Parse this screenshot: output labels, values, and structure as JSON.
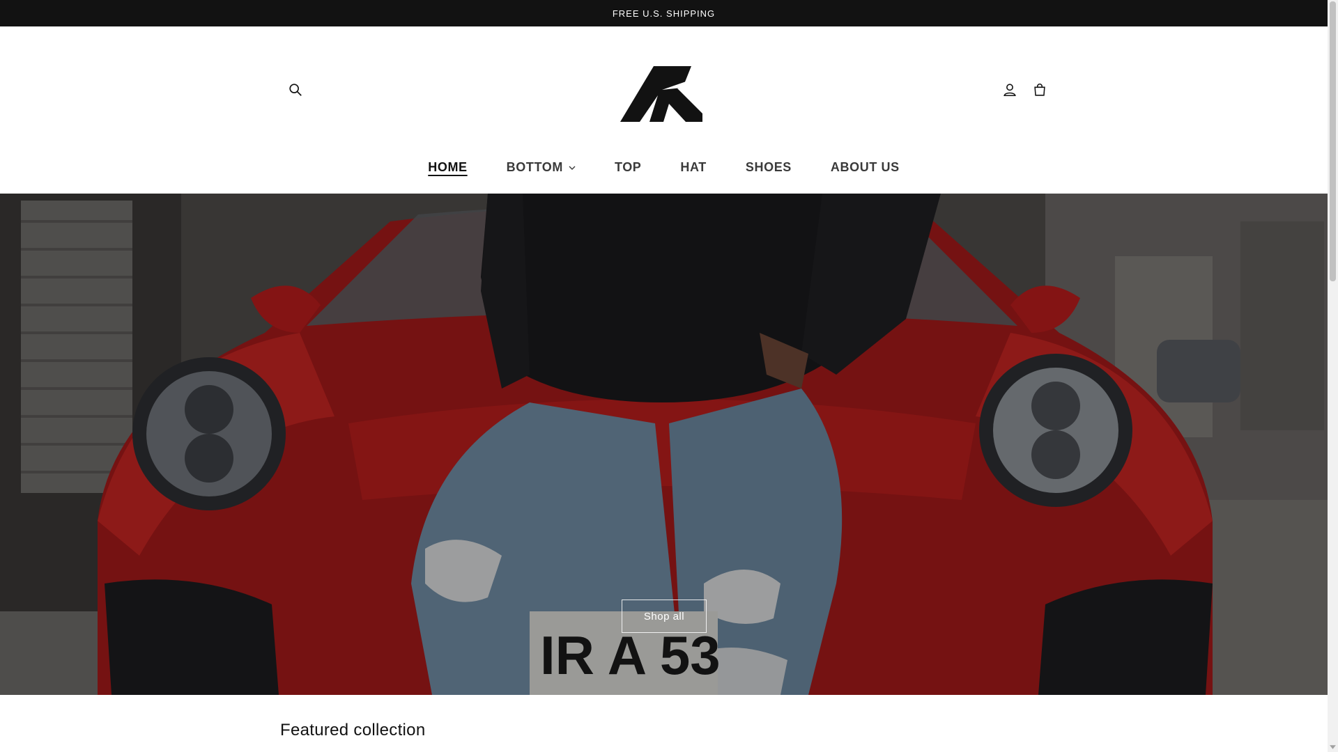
{
  "announcement": {
    "text": "FREE U.S. SHIPPING"
  },
  "header": {
    "logo_alt": "brand-logo",
    "icons": {
      "search": "search-icon",
      "account": "account-icon",
      "cart": "cart-icon"
    }
  },
  "nav": {
    "items": [
      {
        "label": "HOME",
        "active": true
      },
      {
        "label": "BOTTOM",
        "has_dropdown": true
      },
      {
        "label": "TOP"
      },
      {
        "label": "HAT"
      },
      {
        "label": "SHOES"
      },
      {
        "label": "ABOUT US"
      }
    ]
  },
  "hero": {
    "image_plate": "IR A 53",
    "button_label": "Shop all"
  },
  "featured": {
    "title": "Featured collection"
  },
  "colors": {
    "announcement_bg": "#121212",
    "text": "#121212",
    "car_red": "#c0201e"
  }
}
